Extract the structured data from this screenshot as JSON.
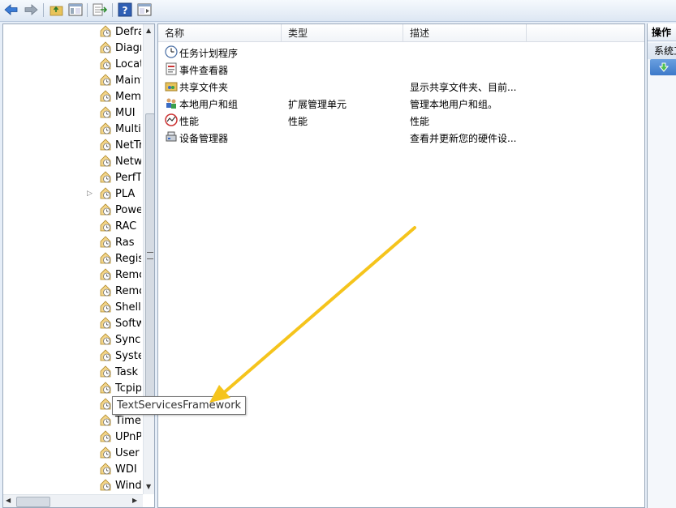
{
  "toolbar": {
    "buttons": [
      "back-icon",
      "forward-icon",
      "up-folder-icon",
      "show-hide-tree-icon",
      "export-list-icon",
      "help-icon",
      "show-hide-action-pane-icon"
    ]
  },
  "tree": {
    "items": [
      {
        "label": "Defra"
      },
      {
        "label": "Diagr"
      },
      {
        "label": "Locat"
      },
      {
        "label": "Maint"
      },
      {
        "label": "Mem"
      },
      {
        "label": "MUI"
      },
      {
        "label": "Multi"
      },
      {
        "label": "NetTr"
      },
      {
        "label": "Netw"
      },
      {
        "label": "PerfT"
      },
      {
        "label": "PLA",
        "expandable": true
      },
      {
        "label": "Powe"
      },
      {
        "label": "RAC"
      },
      {
        "label": "Ras"
      },
      {
        "label": "Regis"
      },
      {
        "label": "Remc"
      },
      {
        "label": "Remc"
      },
      {
        "label": "Shell"
      },
      {
        "label": "Softw"
      },
      {
        "label": "SyncC"
      },
      {
        "label": "Syste"
      },
      {
        "label": "Task"
      },
      {
        "label": "Tcpip"
      },
      {
        "label": ""
      },
      {
        "label": "Time"
      },
      {
        "label": "UPnP"
      },
      {
        "label": "User"
      },
      {
        "label": "WDI"
      },
      {
        "label": "Wind"
      }
    ],
    "tooltip": "TextServicesFramework"
  },
  "main": {
    "columns": [
      "名称",
      "类型",
      "描述"
    ],
    "rows": [
      {
        "name": "任务计划程序",
        "type": "",
        "desc": "",
        "icon": "clock-icon"
      },
      {
        "name": "事件查看器",
        "type": "",
        "desc": "",
        "icon": "event-viewer-icon"
      },
      {
        "name": "共享文件夹",
        "type": "",
        "desc": "显示共享文件夹、目前...",
        "icon": "shared-folder-icon"
      },
      {
        "name": "本地用户和组",
        "type": "扩展管理单元",
        "desc": "管理本地用户和组。",
        "icon": "users-icon"
      },
      {
        "name": "性能",
        "type": "性能",
        "desc": "性能",
        "icon": "performance-icon"
      },
      {
        "name": "设备管理器",
        "type": "",
        "desc": "查看并更新您的硬件设...",
        "icon": "device-manager-icon"
      }
    ]
  },
  "actions": {
    "header": "操作",
    "section": "系统工"
  },
  "colors": {
    "annotation_arrow": "#f5c41c",
    "tree_icon": "#e8b84a",
    "action_button": "#3d79c9"
  }
}
